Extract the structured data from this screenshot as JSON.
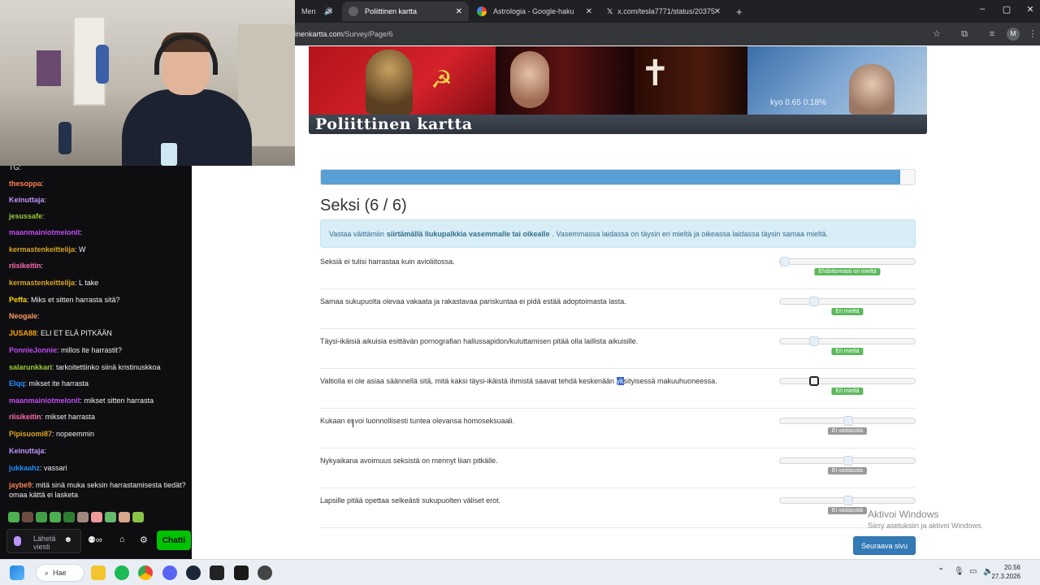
{
  "browser": {
    "tabs": [
      {
        "label": "Men",
        "active": false
      },
      {
        "label": "Poliittinen kartta",
        "active": true
      },
      {
        "label": "Astrologia - Google-haku",
        "active": false
      },
      {
        "label": "x.com/tesla7771/status/20375",
        "active": false
      }
    ],
    "url_host": "inenkartta.com",
    "url_path": "/Survey/Page/6",
    "profile_initial": "M"
  },
  "banner": {
    "title": "Poliittinen kartta",
    "ticker": "kyo   0.65     0.18%"
  },
  "survey": {
    "progress_percent": 97.5,
    "section_title": "Seksi (6 / 6)",
    "instruction_pre": "Vastaa väittämiin",
    "instruction_bold": "siirtämällä liukupalkkia vasemmalle tai oikealle",
    "instruction_post": ". Vasemmassa laidassa on täysin eri mieltä ja oikeassa laidassa täysin samaa mieltä.",
    "questions": [
      {
        "text": "Seksiä ei tulisi harrastaa kuin avioliitossa.",
        "value": 0.0,
        "label": "Ehdottomasti eri mieltä",
        "label_color": "green",
        "active": false
      },
      {
        "text": "Samaa sukupuolta olevaa vakaata ja rakastavaa pariskuntaa ei pidä estää adoptoimasta lasta.",
        "value": 0.25,
        "label": "Eri mieltä",
        "label_color": "green",
        "active": false
      },
      {
        "text": "Täysi-ikäisiä aikuisia esittävän pornografian hallussapidon/kuluttamisen pitää olla laillista aikuisille.",
        "value": 0.25,
        "label": "Eri mieltä",
        "label_color": "green",
        "active": false
      },
      {
        "text_before": "Valtiolla ei ole asiaa säännellä sitä, mitä kaksi täysi-ikäistä ihmistä saavat tehdä keskenään ",
        "text_selected": "yk",
        "text_after": "sityisessä makuuhuoneessa.",
        "value": 0.25,
        "label": "Eri mieltä",
        "label_color": "green",
        "active": true
      },
      {
        "text": "Kukaan ei voi luonnollisesti tuntea olevansa homoseksuaali.",
        "value": 0.5,
        "label": "Ei vastausta",
        "label_color": "gray",
        "active": false
      },
      {
        "text": "Nykyaikana avoimuus seksistä on mennyt liian pitkälle.",
        "value": 0.5,
        "label": "Ei vastausta",
        "label_color": "gray",
        "active": false
      },
      {
        "text": "Lapsille pitää opettaa selkeästi sukupuolten väliset erot.",
        "value": 0.5,
        "label": "Ei vastausta",
        "label_color": "gray",
        "active": false
      }
    ],
    "next_button": "Seuraava sivu"
  },
  "windows_watermark": {
    "line1": "Aktivoi Windows",
    "line2": "Siirry asetuksiin ja aktivoi Windows."
  },
  "chat": {
    "messages": [
      {
        "name": "",
        "text": "TG:",
        "color": "#efeff1"
      },
      {
        "name": "thesoppa",
        "text": ":",
        "color": "#ff7f50"
      },
      {
        "name": "Keinuttaja",
        "text": ":",
        "color": "#bf94ff"
      },
      {
        "name": "jesussafe",
        "text": ":",
        "color": "#9acd32"
      },
      {
        "name": "maanmainiotmelonit",
        "text": ":",
        "color": "#c04cf2"
      },
      {
        "name": "kermastenkeittelija",
        "text": ": W",
        "color": "#daa520"
      },
      {
        "name": "riisikeitin",
        "text": ":",
        "color": "#ff69b4"
      },
      {
        "name": "kermastenkeittelija",
        "text": ": L take",
        "color": "#daa520"
      },
      {
        "name": "Peffa",
        "text": ": Miks et sitten harrasta sitä?",
        "color": "#ffd700"
      },
      {
        "name": "Neogale",
        "text": ":",
        "color": "#ff9966"
      },
      {
        "name": "JUSA88",
        "text": ": ELI ET ELÄ PITKÄÄN",
        "color": "#ffa500"
      },
      {
        "name": "PonnieJonnie",
        "text": ": millos ite harrastit?",
        "color": "#c04cf2"
      },
      {
        "name": "salarunkkari",
        "text": ": tarkoitettiinko siinä kristinuskkoa",
        "color": "#9acd32"
      },
      {
        "name": "Elqq",
        "text": ": mikset ite harrasta",
        "color": "#1e90ff"
      },
      {
        "name": "maanmainiotmelonit",
        "text": ": mikset sitten harrasta",
        "color": "#c04cf2"
      },
      {
        "name": "riisikeitin",
        "text": ": mikset harrasta",
        "color": "#ff69b4"
      },
      {
        "name": "Pipisuomi87",
        "text": ": nopeemmin",
        "color": "#daa520"
      },
      {
        "name": "Keinuttaja",
        "text": ":",
        "color": "#bf94ff"
      },
      {
        "name": "jukkaahz",
        "text": ": vassari",
        "color": "#1e90ff"
      },
      {
        "name": "jaybe9",
        "text": ": mitä sinä muka seksin harrastamisesta tiedät? omaa kättä ei lasketa",
        "color": "#ff7f50"
      }
    ],
    "input_placeholder": "Lähetä viesti",
    "send_label": "Chatti"
  },
  "taskbar": {
    "search_label": "Hae",
    "time": "20.56",
    "date": "27.3.2026"
  }
}
